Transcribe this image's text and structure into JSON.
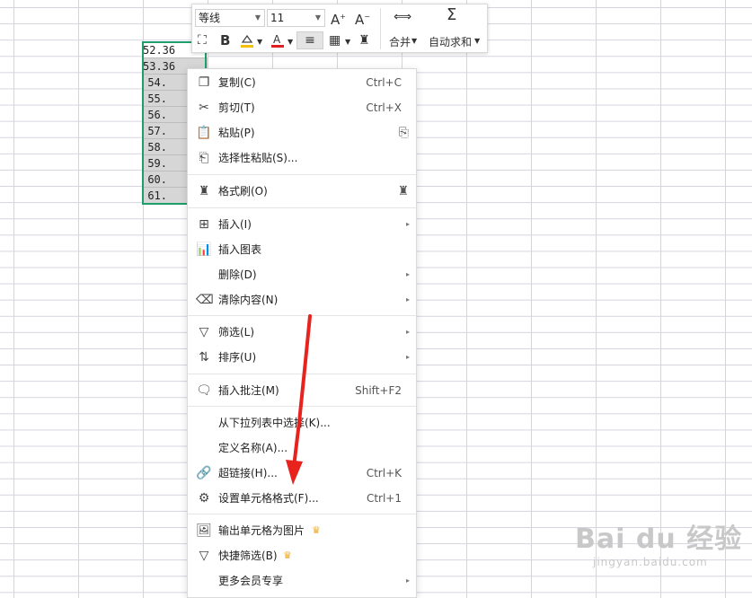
{
  "cells": [
    "52.36",
    "53.36",
    "54.",
    "55.",
    "56.",
    "57.",
    "58.",
    "59.",
    "60.",
    "61."
  ],
  "toolbar": {
    "font_name": "等线",
    "font_size": "11",
    "merge_label": "合并",
    "autosum_label": "自动求和",
    "font_color": "#e02020",
    "fill_color": "#f6c000"
  },
  "menu": {
    "copy": {
      "label": "复制(C)",
      "shortcut": "Ctrl+C"
    },
    "cut": {
      "label": "剪切(T)",
      "shortcut": "Ctrl+X"
    },
    "paste": {
      "label": "粘贴(P)"
    },
    "paste_special": {
      "label": "选择性粘贴(S)..."
    },
    "format_painter": {
      "label": "格式刷(O)"
    },
    "insert": {
      "label": "插入(I)"
    },
    "insert_chart": {
      "label": "插入图表"
    },
    "delete": {
      "label": "删除(D)"
    },
    "clear": {
      "label": "清除内容(N)"
    },
    "filter": {
      "label": "筛选(L)"
    },
    "sort": {
      "label": "排序(U)"
    },
    "insert_comment": {
      "label": "插入批注(M)",
      "shortcut": "Shift+F2"
    },
    "pick_from_list": {
      "label": "从下拉列表中选择(K)..."
    },
    "define_name": {
      "label": "定义名称(A)..."
    },
    "hyperlink": {
      "label": "超链接(H)...",
      "shortcut": "Ctrl+K"
    },
    "format_cells": {
      "label": "设置单元格格式(F)...",
      "shortcut": "Ctrl+1"
    },
    "export_image": {
      "label": "输出单元格为图片"
    },
    "quick_filter": {
      "label": "快捷筛选(B)"
    },
    "more_member": {
      "label": "更多会员专享"
    }
  },
  "watermark": {
    "main": "Bai du 经验",
    "sub": "jingyan.baidu.com"
  },
  "annotation_color": "#e8231e"
}
